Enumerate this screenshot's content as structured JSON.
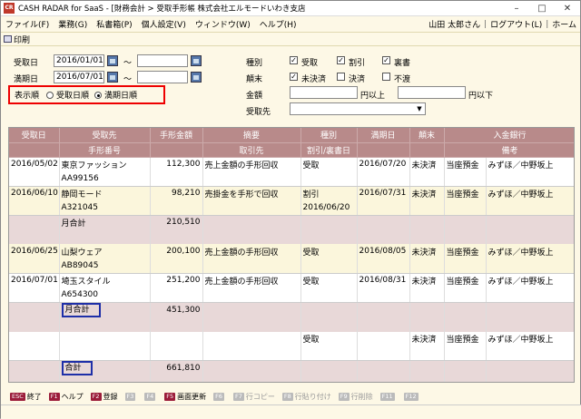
{
  "window": {
    "title": "CASH RADAR for SaaS - [財務会計 > 受取手形帳 株式会社エルモードいわき支店",
    "icon_text": "CR"
  },
  "menu": {
    "items": [
      "ファイル(F)",
      "業務(G)",
      "私書箱(P)",
      "個人設定(V)",
      "ウィンドウ(W)",
      "ヘルプ(H)"
    ],
    "user": "山田 太郎さん",
    "logout": "ログアウト(L)",
    "home": "ホーム"
  },
  "toolbar": {
    "print": "印刷"
  },
  "filter": {
    "received_date_label": "受取日",
    "received_from": "2016/01/01",
    "received_to": "",
    "maturity_date_label": "満期日",
    "maturity_from": "2016/07/01",
    "maturity_to": "",
    "tilde": "～",
    "order_label": "表示順",
    "order_opt1": "受取日順",
    "order_opt2": "満期日順",
    "type_label": "種別",
    "type_opts": [
      "受取",
      "割引",
      "裏書"
    ],
    "settle_label": "顛末",
    "settle_opts": [
      "未決済",
      "決済",
      "不渡"
    ],
    "amount_label": "金額",
    "amount_min_suffix": "円以上",
    "amount_max_suffix": "円以下",
    "from_label": "受取先"
  },
  "grid": {
    "header1": [
      "受取日",
      "受取先",
      "手形金額",
      "摘要",
      "種別",
      "満期日",
      "顛末",
      "入金銀行"
    ],
    "header2": [
      "",
      "手形番号",
      "",
      "取引先",
      "割引/裏書日",
      "",
      "",
      "備考"
    ],
    "rows": [
      {
        "style": "w",
        "cells": [
          "2016/05/02",
          "東京ファッション",
          "112,300",
          "売上金額の手形回収",
          "受取",
          "2016/07/20",
          "未決済",
          "当座預金",
          "みずほ／中野坂上"
        ]
      },
      {
        "style": "w sub",
        "cells": [
          "",
          "AA99156",
          "",
          "",
          "",
          "",
          "",
          "",
          ""
        ]
      },
      {
        "style": "y",
        "cells": [
          "2016/06/10",
          "静岡モード",
          "98,210",
          "売掛金を手形で回収",
          "割引",
          "2016/07/31",
          "未決済",
          "当座預金",
          "みずほ／中野坂上"
        ]
      },
      {
        "style": "y sub",
        "cells": [
          "",
          "A321045",
          "",
          "",
          "2016/06/20",
          "",
          "",
          "",
          ""
        ]
      },
      {
        "style": "p",
        "cells": [
          "",
          "月合計",
          "210,510",
          "",
          "",
          "",
          "",
          "",
          ""
        ]
      },
      {
        "style": "p",
        "cells": [
          "",
          "",
          "",
          "",
          "",
          "",
          "",
          "",
          ""
        ]
      },
      {
        "style": "y",
        "cells": [
          "2016/06/25",
          "山梨ウェア",
          "200,100",
          "売上金額の手形回収",
          "受取",
          "2016/08/05",
          "未決済",
          "当座預金",
          "みずほ／中野坂上"
        ]
      },
      {
        "style": "y sub",
        "cells": [
          "",
          "AB89045",
          "",
          "",
          "",
          "",
          "",
          "",
          ""
        ]
      },
      {
        "style": "w",
        "cells": [
          "2016/07/01",
          "埼玉スタイル",
          "251,200",
          "売上金額の手形回収",
          "受取",
          "2016/08/31",
          "未決済",
          "当座預金",
          "みずほ／中野坂上"
        ]
      },
      {
        "style": "w sub",
        "cells": [
          "",
          "A654300",
          "",
          "",
          "",
          "",
          "",
          "",
          ""
        ]
      },
      {
        "style": "p",
        "cells": [
          "",
          "月合計",
          "451,300",
          "",
          "",
          "",
          "",
          "",
          ""
        ]
      },
      {
        "style": "p",
        "cells": [
          "",
          "",
          "",
          "",
          "",
          "",
          "",
          "",
          ""
        ]
      },
      {
        "style": "w",
        "cells": [
          "",
          "",
          "",
          "",
          "受取",
          "",
          "未決済",
          "当座預金",
          "みずほ／中野坂上"
        ]
      },
      {
        "style": "w sub",
        "cells": [
          "",
          "",
          "",
          "",
          "",
          "",
          "",
          "",
          ""
        ]
      },
      {
        "style": "p",
        "cells": [
          "",
          "合計",
          "661,810",
          "",
          "",
          "",
          "",
          "",
          ""
        ]
      },
      {
        "style": "p",
        "cells": [
          "",
          "",
          "",
          "",
          "",
          "",
          "",
          "",
          ""
        ]
      }
    ]
  },
  "fkeys": [
    {
      "key": "ESC",
      "label": "終了",
      "on": true
    },
    {
      "key": "F1",
      "label": "ヘルプ",
      "on": true
    },
    {
      "key": "F2",
      "label": "登録",
      "on": true
    },
    {
      "key": "F3",
      "label": "",
      "on": false
    },
    {
      "key": "F4",
      "label": "",
      "on": false
    },
    {
      "key": "F5",
      "label": "画面更新",
      "on": true
    },
    {
      "key": "F6",
      "label": "",
      "on": false
    },
    {
      "key": "F7",
      "label": "行コピー",
      "on": false
    },
    {
      "key": "F8",
      "label": "行貼り付け",
      "on": false
    },
    {
      "key": "F9",
      "label": "行削除",
      "on": false
    },
    {
      "key": "F11",
      "label": "",
      "on": false
    },
    {
      "key": "F12",
      "label": "",
      "on": false
    }
  ],
  "colors": {
    "header_bg": "#b88a8a",
    "highlight_red": "#e00000",
    "highlight_blue": "#1e2fa8",
    "fkey": "#9b1c3a"
  }
}
